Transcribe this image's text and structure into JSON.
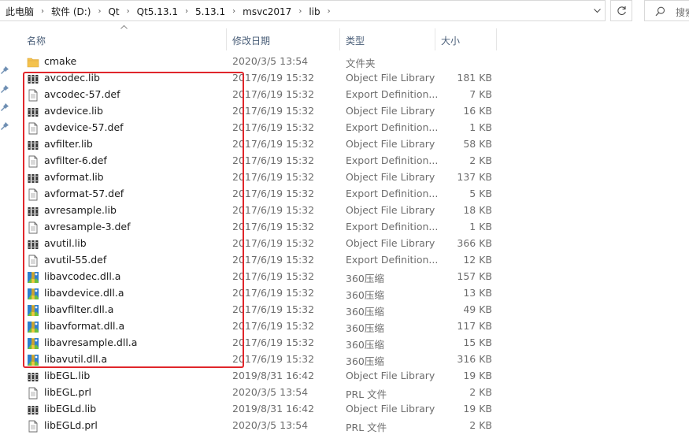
{
  "address": {
    "crumbs": [
      "此电脑",
      "软件 (D:)",
      "Qt",
      "Qt5.13.1",
      "5.13.1",
      "msvc2017",
      "lib"
    ],
    "separator": "›",
    "dropdown_icon": "chevron-down-icon",
    "refresh_icon": "refresh-icon"
  },
  "search": {
    "placeholder": "搜索"
  },
  "columns": {
    "name": "名称",
    "date": "修改日期",
    "type": "类型",
    "size": "大小"
  },
  "rows": [
    {
      "icon": "folder",
      "name": "cmake",
      "date": "2020/3/5 13:54",
      "type": "文件夹",
      "size": ""
    },
    {
      "icon": "lib",
      "name": "avcodec.lib",
      "date": "2017/6/19 15:32",
      "type": "Object File Library",
      "size": "181 KB"
    },
    {
      "icon": "doc",
      "name": "avcodec-57.def",
      "date": "2017/6/19 15:32",
      "type": "Export Definition...",
      "size": "7 KB"
    },
    {
      "icon": "lib",
      "name": "avdevice.lib",
      "date": "2017/6/19 15:32",
      "type": "Object File Library",
      "size": "16 KB"
    },
    {
      "icon": "doc",
      "name": "avdevice-57.def",
      "date": "2017/6/19 15:32",
      "type": "Export Definition...",
      "size": "1 KB"
    },
    {
      "icon": "lib",
      "name": "avfilter.lib",
      "date": "2017/6/19 15:32",
      "type": "Object File Library",
      "size": "58 KB"
    },
    {
      "icon": "doc",
      "name": "avfilter-6.def",
      "date": "2017/6/19 15:32",
      "type": "Export Definition...",
      "size": "2 KB"
    },
    {
      "icon": "lib",
      "name": "avformat.lib",
      "date": "2017/6/19 15:32",
      "type": "Object File Library",
      "size": "137 KB"
    },
    {
      "icon": "doc",
      "name": "avformat-57.def",
      "date": "2017/6/19 15:32",
      "type": "Export Definition...",
      "size": "5 KB"
    },
    {
      "icon": "lib",
      "name": "avresample.lib",
      "date": "2017/6/19 15:32",
      "type": "Object File Library",
      "size": "18 KB"
    },
    {
      "icon": "doc",
      "name": "avresample-3.def",
      "date": "2017/6/19 15:32",
      "type": "Export Definition...",
      "size": "1 KB"
    },
    {
      "icon": "lib",
      "name": "avutil.lib",
      "date": "2017/6/19 15:32",
      "type": "Object File Library",
      "size": "366 KB"
    },
    {
      "icon": "doc",
      "name": "avutil-55.def",
      "date": "2017/6/19 15:32",
      "type": "Export Definition...",
      "size": "12 KB"
    },
    {
      "icon": "archive",
      "name": "libavcodec.dll.a",
      "date": "2017/6/19 15:32",
      "type": "360压缩",
      "size": "157 KB"
    },
    {
      "icon": "archive",
      "name": "libavdevice.dll.a",
      "date": "2017/6/19 15:32",
      "type": "360压缩",
      "size": "13 KB"
    },
    {
      "icon": "archive",
      "name": "libavfilter.dll.a",
      "date": "2017/6/19 15:32",
      "type": "360压缩",
      "size": "49 KB"
    },
    {
      "icon": "archive",
      "name": "libavformat.dll.a",
      "date": "2017/6/19 15:32",
      "type": "360压缩",
      "size": "117 KB"
    },
    {
      "icon": "archive",
      "name": "libavresample.dll.a",
      "date": "2017/6/19 15:32",
      "type": "360压缩",
      "size": "15 KB"
    },
    {
      "icon": "archive",
      "name": "libavutil.dll.a",
      "date": "2017/6/19 15:32",
      "type": "360压缩",
      "size": "316 KB"
    },
    {
      "icon": "lib",
      "name": "libEGL.lib",
      "date": "2019/8/31 16:42",
      "type": "Object File Library",
      "size": "19 KB"
    },
    {
      "icon": "doc",
      "name": "libEGL.prl",
      "date": "2020/3/5 13:54",
      "type": "PRL 文件",
      "size": "2 KB"
    },
    {
      "icon": "lib",
      "name": "libEGLd.lib",
      "date": "2019/8/31 16:42",
      "type": "Object File Library",
      "size": "19 KB"
    },
    {
      "icon": "doc",
      "name": "libEGLd.prl",
      "date": "2020/3/5 13:54",
      "type": "PRL 文件",
      "size": "2 KB"
    }
  ],
  "colors": {
    "highlight": "#e0262b",
    "folder": "#f4c24d",
    "header_text": "#4c607a"
  }
}
